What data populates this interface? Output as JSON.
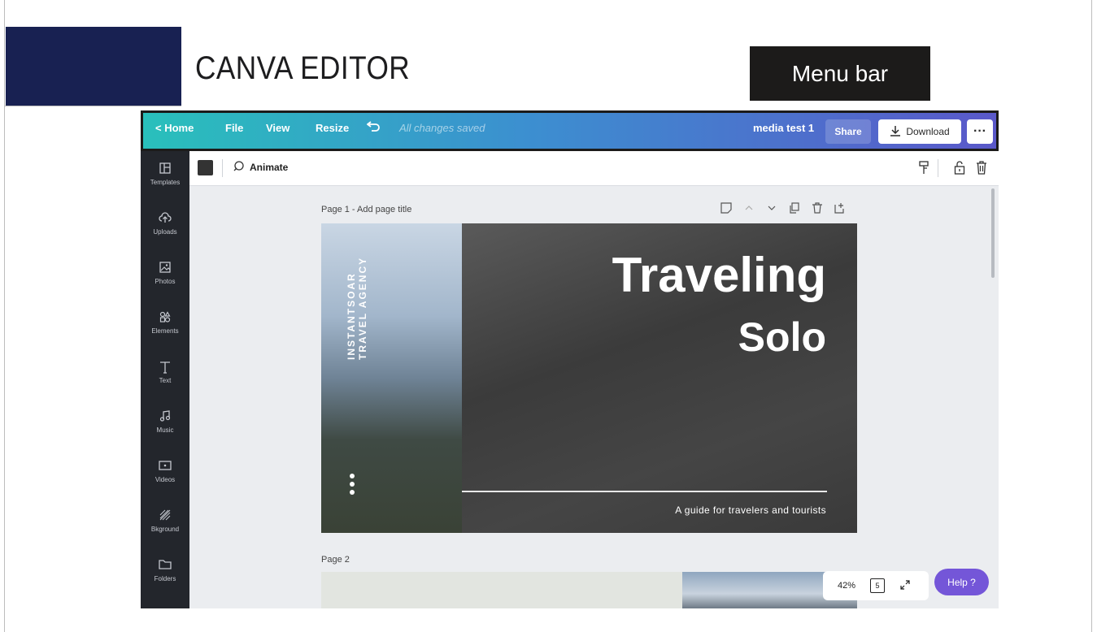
{
  "slide": {
    "title": "CANVA EDITOR",
    "callout": "Menu bar"
  },
  "menubar": {
    "home": "< Home",
    "file": "File",
    "view": "View",
    "resize": "Resize",
    "status": "All changes saved",
    "doc_name": "media test 1",
    "share": "Share",
    "download": "Download",
    "more": "···"
  },
  "sidebar": {
    "items": [
      {
        "label": "Templates",
        "icon": "templates-icon"
      },
      {
        "label": "Uploads",
        "icon": "upload-cloud-icon"
      },
      {
        "label": "Photos",
        "icon": "photos-icon"
      },
      {
        "label": "Elements",
        "icon": "elements-icon"
      },
      {
        "label": "Text",
        "icon": "text-icon"
      },
      {
        "label": "Music",
        "icon": "music-icon"
      },
      {
        "label": "Videos",
        "icon": "videos-icon"
      },
      {
        "label": "Bkground",
        "icon": "background-icon"
      },
      {
        "label": "Folders",
        "icon": "folder-icon"
      }
    ]
  },
  "toolbar": {
    "animate": "Animate",
    "swatch_color": "#333333"
  },
  "pages": [
    {
      "label": "Page 1 - Add page title",
      "vertical_text_1": "INSTANTSOAR",
      "vertical_text_2": "TRAVEL AGENCY",
      "heading_1": "Traveling",
      "heading_2": "Solo",
      "subtitle": "A guide for travelers and tourists"
    },
    {
      "label": "Page 2"
    }
  ],
  "footer": {
    "zoom": "42%",
    "pages_count": "5",
    "help": "Help ?"
  },
  "colors": {
    "navy": "#182152",
    "accent_purple": "#7456d8",
    "gradient_start": "#29c0bb",
    "gradient_end": "#5a58c9"
  }
}
